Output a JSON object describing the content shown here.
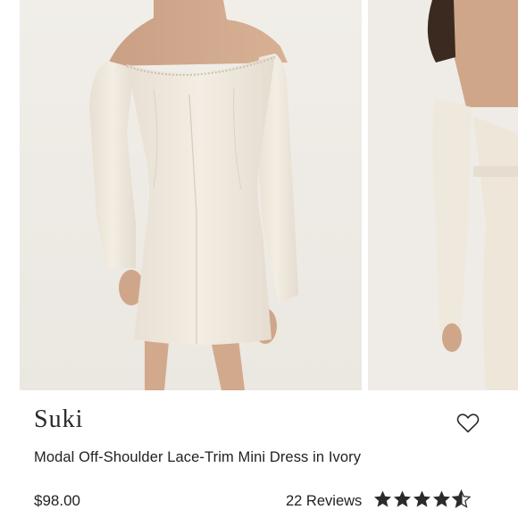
{
  "product": {
    "brand": "Suki",
    "title": "Modal Off-Shoulder Lace-Trim Mini Dress in Ivory",
    "price": "$98.00",
    "reviews_label": "22 Reviews",
    "rating_stars": 4.5,
    "wishlist_icon": "heart-outline-icon",
    "star_icon": "star-icon"
  },
  "colors": {
    "dress": "#efe8dc",
    "photo_background": "#efece7",
    "text": "#222222",
    "star": "#2b2b2b"
  }
}
